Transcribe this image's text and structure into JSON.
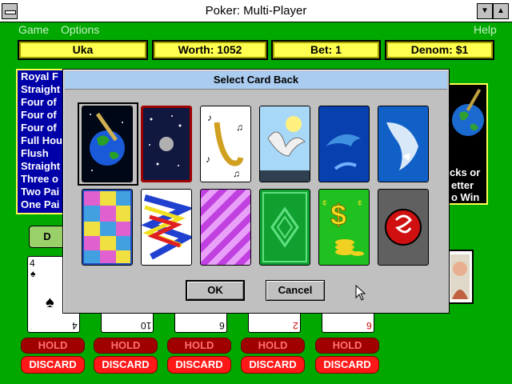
{
  "window": {
    "title": "Poker: Multi-Player"
  },
  "menu": {
    "game": "Game",
    "options": "Options",
    "help": "Help"
  },
  "header": {
    "player": "Uka",
    "worth": "Worth: 1052",
    "bet": "Bet: 1",
    "denom": "Denom: $1"
  },
  "payouts": [
    "Royal F",
    "Straight",
    "Four of",
    "Four of",
    "Four of",
    "Full Hou",
    "Flush",
    "Straight",
    "Three o",
    "Two Pai",
    "One Pai"
  ],
  "right_panel": {
    "line1": "cks or",
    "line2": "etter",
    "line3": "o Win"
  },
  "deal_label": "D",
  "cards": [
    {
      "rank": "4",
      "suit": "♠",
      "color": "#000000"
    },
    {
      "rank": "10",
      "suit": "♠",
      "color": "#000000"
    },
    {
      "rank": "6",
      "suit": "♠",
      "color": "#000000"
    },
    {
      "rank": "2",
      "suit": "♦",
      "color": "#cc0000"
    },
    {
      "rank": "6",
      "suit": "♦",
      "color": "#cc0000"
    }
  ],
  "hold_label": "HOLD",
  "discard_label": "DISCARD",
  "dialog": {
    "title": "Select Card Back",
    "ok": "OK",
    "cancel": "Cancel",
    "backs": [
      {
        "name": "earth-sword"
      },
      {
        "name": "moon-space"
      },
      {
        "name": "saxophone"
      },
      {
        "name": "seagull"
      },
      {
        "name": "dolphin"
      },
      {
        "name": "shark"
      },
      {
        "name": "stained-glass"
      },
      {
        "name": "zigzag"
      },
      {
        "name": "purple-stripes"
      },
      {
        "name": "celtic-knot"
      },
      {
        "name": "money"
      },
      {
        "name": "snake"
      }
    ]
  },
  "colors": {
    "felt": "#00a800",
    "header": "#ffff50",
    "payout_bg": "#0000a8",
    "discard": "#ff1818",
    "hold": "#a00000"
  }
}
